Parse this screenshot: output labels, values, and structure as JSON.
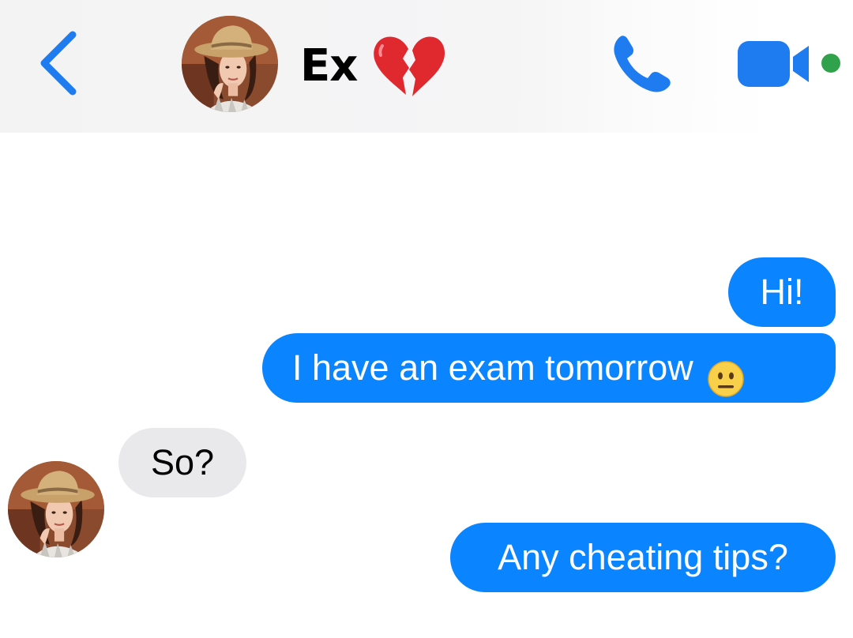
{
  "header": {
    "back_icon": "chevron-left-icon",
    "contact_name": "Ex",
    "status_icon": "broken-heart-emoji",
    "call_icon": "phone-icon",
    "video_icon": "video-camera-icon",
    "active_status_color": "#31a24c",
    "accent_color": "#0a84ff"
  },
  "messages": [
    {
      "direction": "outgoing",
      "text": "Hi!"
    },
    {
      "direction": "outgoing",
      "text": "I have an exam tomorrow",
      "emoji": "neutral-face-emoji"
    },
    {
      "direction": "incoming",
      "text": "So?"
    },
    {
      "direction": "outgoing",
      "text": "Any cheating tips?"
    }
  ],
  "colors": {
    "outgoing_bubble": "#0a84ff",
    "incoming_bubble": "#e9e9eb"
  }
}
